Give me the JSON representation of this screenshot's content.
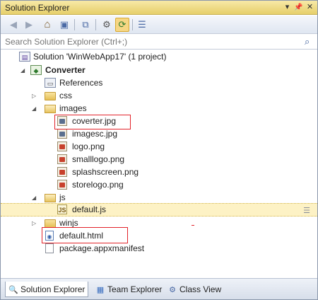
{
  "window": {
    "title": "Solution Explorer",
    "controls": {
      "dropdown_glyph": "▾",
      "pin_glyph": "📌",
      "close_glyph": "✕"
    }
  },
  "toolbar": {
    "buttons": [
      {
        "name": "back-button",
        "glyph": "◀",
        "icon": "back-arrow-icon"
      },
      {
        "name": "forward-button",
        "glyph": "▶",
        "icon": "forward-arrow-icon"
      },
      {
        "name": "home-button",
        "glyph": "⌂",
        "icon": "home-icon"
      },
      {
        "name": "pending-changes-button",
        "glyph": "▣",
        "icon": "pending-changes-icon"
      },
      {
        "name": "collapse-all-button",
        "glyph": "⧉",
        "icon": "collapse-all-icon"
      },
      {
        "name": "properties-button",
        "glyph": "⚙",
        "icon": "properties-icon"
      },
      {
        "name": "show-all-files-button",
        "glyph": "⟳",
        "icon": "sync-icon"
      },
      {
        "name": "preview-button",
        "glyph": "☰",
        "icon": "preview-icon"
      }
    ]
  },
  "search": {
    "placeholder": "Search Solution Explorer (Ctrl+;)",
    "icon_glyph": "⌕"
  },
  "tree": {
    "solution": "Solution 'WinWebApp17' (1 project)",
    "project": "Converter",
    "items": [
      {
        "label": "References",
        "icon": "references-icon"
      },
      {
        "label": "css",
        "icon": "folder-icon"
      },
      {
        "label": "images",
        "icon": "folder-open-icon"
      },
      {
        "label": "coverter.jpg",
        "icon": "image-file-icon"
      },
      {
        "label": "imagesc.jpg",
        "icon": "image-file-icon"
      },
      {
        "label": "logo.png",
        "icon": "image-file-icon"
      },
      {
        "label": "smalllogo.png",
        "icon": "image-file-icon"
      },
      {
        "label": "splashscreen.png",
        "icon": "image-file-icon"
      },
      {
        "label": "storelogo.png",
        "icon": "image-file-icon"
      },
      {
        "label": "js",
        "icon": "folder-open-icon"
      },
      {
        "label": "default.js",
        "icon": "js-file-icon"
      },
      {
        "label": "winjs",
        "icon": "folder-icon"
      },
      {
        "label": "default.html",
        "icon": "html-file-icon"
      },
      {
        "label": "package.appxmanifest",
        "icon": "manifest-file-icon"
      }
    ],
    "glyphs": {
      "expanded": "◢",
      "collapsed": "▷",
      "js_badge": "JS",
      "html_badge": "◉",
      "solution_badge": "▤",
      "project_badge": "◆",
      "refs_badge": "▭"
    }
  },
  "bottom_tabs": [
    {
      "label": "Solution Explorer",
      "icon_glyph": "🔍"
    },
    {
      "label": "Team Explorer",
      "icon_glyph": "▦"
    },
    {
      "label": "Class View",
      "icon_glyph": "⚙"
    }
  ],
  "colors": {
    "title_gradient_top": "#f7e9a7",
    "title_gradient_bottom": "#e6cf6a",
    "selection_background": "#fdf2c5",
    "highlight_box": "#e2232a"
  }
}
